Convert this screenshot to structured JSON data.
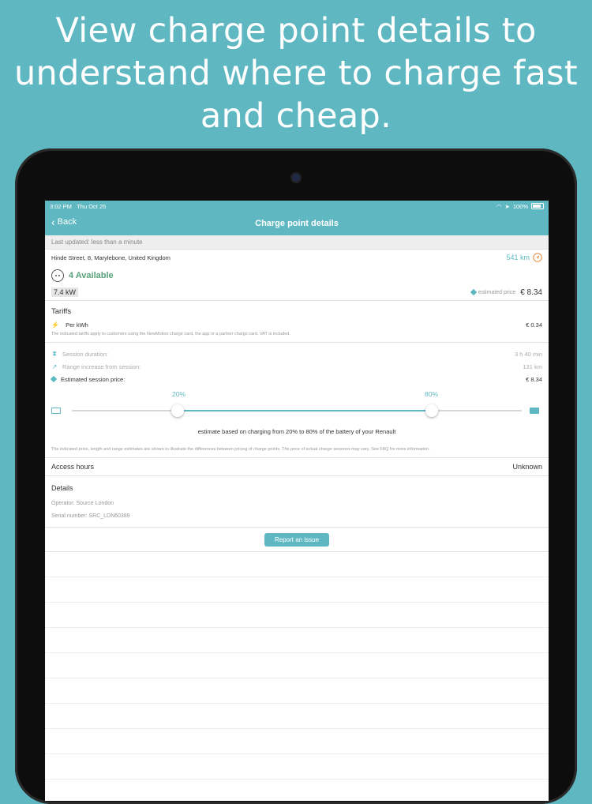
{
  "headline": {
    "line1": "View charge point details to",
    "line2": "understand where to charge fast",
    "line3": "and cheap."
  },
  "statusbar": {
    "time": "3:02 PM",
    "date": "Thu Oct 25",
    "battery": "100%"
  },
  "navbar": {
    "back_label": "Back",
    "title": "Charge point details"
  },
  "last_updated": "Last updated: less than a minute",
  "address": "Hinde Street, 8, Marylebone, United Kingdom",
  "distance": "541 km",
  "availability": "4 Available",
  "power": "7.4 kW",
  "estimated_price_label": "estimated price",
  "estimated_price_value": "€ 8.34",
  "tariffs": {
    "title": "Tariffs",
    "per_kwh_label": "Per kWh",
    "per_kwh_value": "€ 0.34",
    "note": "The indicated tariffs apply to customers using the NewMotion charge card, the app or a partner charge card. VAT is included."
  },
  "session": {
    "duration_label": "Session duration:",
    "duration_value": "3 h 40 min",
    "range_label": "Range increase from session:",
    "range_value": "131 km",
    "price_label": "Estimated session price:",
    "price_value": "€ 8.34"
  },
  "slider": {
    "low_label": "20%",
    "high_label": "80%",
    "low": 20,
    "high": 80
  },
  "estimate_text": "estimate based on charging from 20% to 80% of the battery of your Renault",
  "disclaimer": "The indicated price, length and range estimates are shown to illustrate the differences between pricing of charge points. The price of actual charge sessions may vary. See FAQ for more information.",
  "access": {
    "label": "Access hours",
    "value": "Unknown"
  },
  "details": {
    "title": "Details",
    "operator": "Operator: Source London",
    "serial": "Serial number: SRC_LDN60389"
  },
  "report_button": "Report an issue",
  "colors": {
    "accent": "#5fb8c1",
    "available": "#5aa27a"
  }
}
